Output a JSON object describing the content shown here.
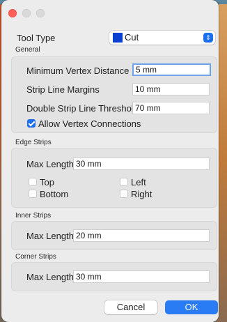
{
  "window": {
    "title": ""
  },
  "tool_type": {
    "label": "Tool Type",
    "value": "Cut",
    "swatch_color": "#0a3fcf"
  },
  "general": {
    "title": "General",
    "min_vertex_distance": {
      "label": "Minimum Vertex Distance",
      "value": "5 mm"
    },
    "strip_line_margins": {
      "label": "Strip Line Margins",
      "value": "10 mm"
    },
    "double_strip_threshold": {
      "label": "Double Strip Line Threshold",
      "value": "70 mm"
    },
    "allow_vertex_connections": {
      "label": "Allow Vertex Connections",
      "checked": true
    }
  },
  "edge_strips": {
    "title": "Edge Strips",
    "max_length": {
      "label": "Max Length",
      "value": "30 mm"
    },
    "top": {
      "label": "Top",
      "checked": false
    },
    "bottom": {
      "label": "Bottom",
      "checked": false
    },
    "left": {
      "label": "Left",
      "checked": false
    },
    "right": {
      "label": "Right",
      "checked": false
    }
  },
  "inner_strips": {
    "title": "Inner Strips",
    "max_length": {
      "label": "Max Length",
      "value": "20 mm"
    }
  },
  "corner_strips": {
    "title": "Corner Strips",
    "max_length": {
      "label": "Max Length",
      "value": "30 mm"
    }
  },
  "buttons": {
    "cancel": "Cancel",
    "ok": "OK"
  },
  "colors": {
    "accent": "#1a6ff0",
    "close": "#fe5f57"
  }
}
